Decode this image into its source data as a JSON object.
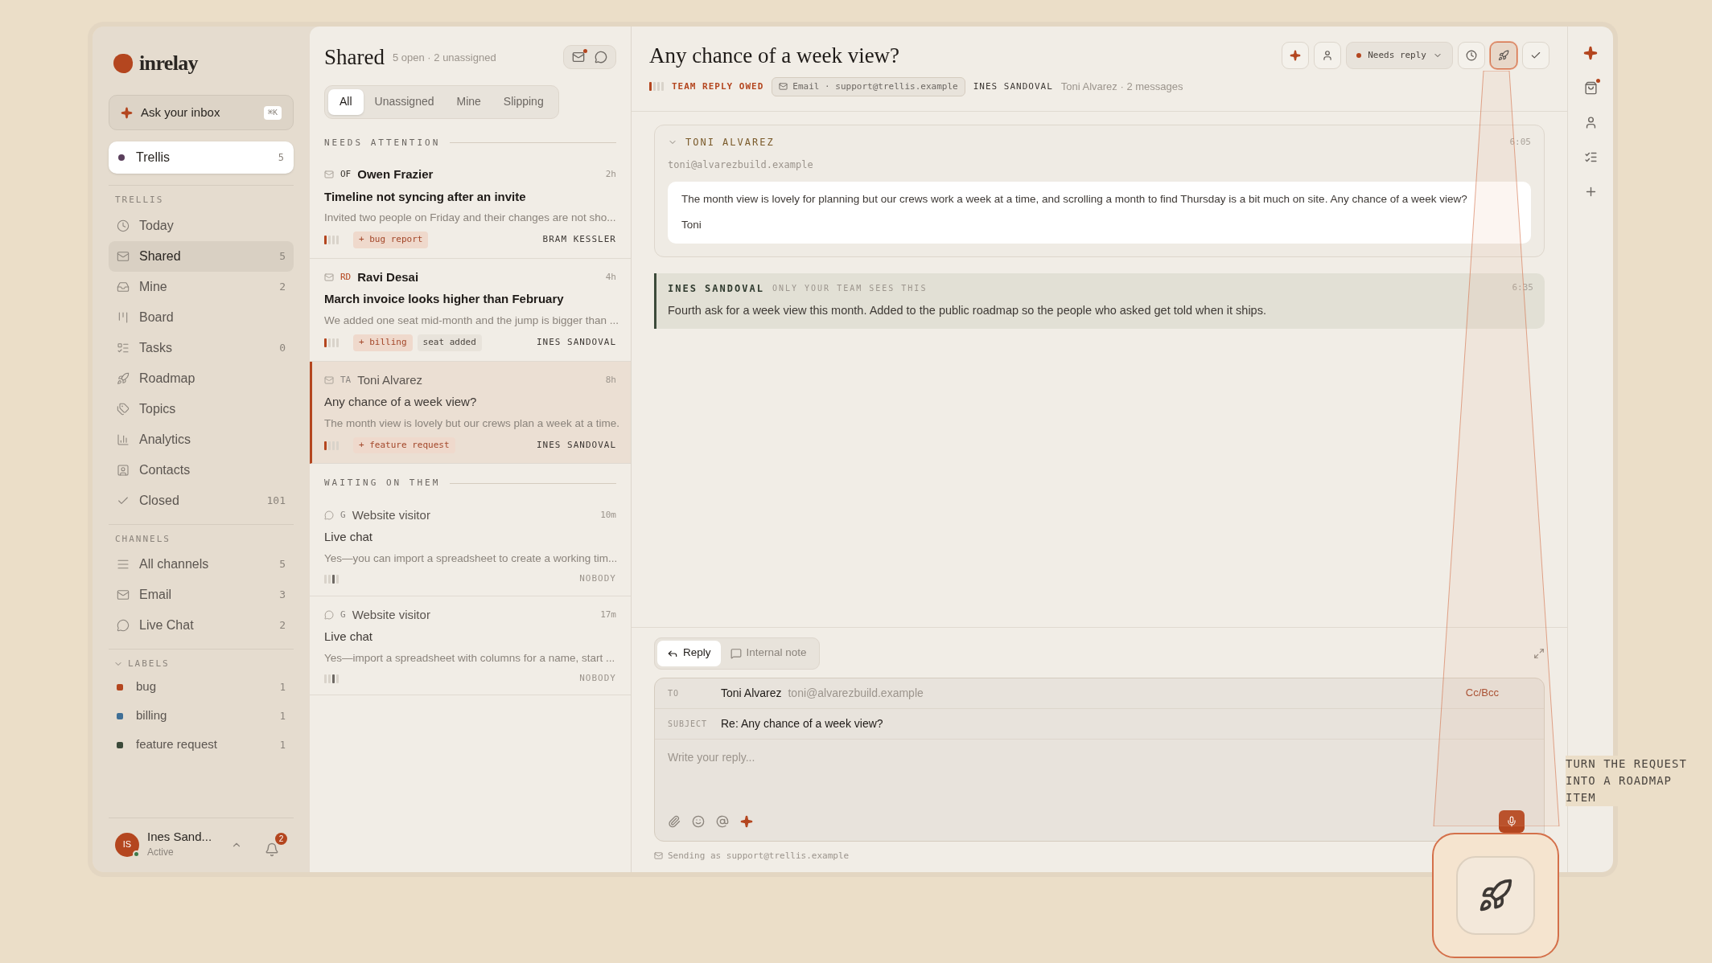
{
  "brand": {
    "name": "inrelay"
  },
  "ask": {
    "label": "Ask your inbox",
    "shortcut": "⌘K"
  },
  "workspace": {
    "name": "Trellis",
    "count": "5",
    "color": "#5a3f5c",
    "selected": true
  },
  "sidebar": {
    "section": "TRELLIS",
    "items": [
      {
        "label": "Today",
        "selected": false
      },
      {
        "label": "Shared",
        "count": "5",
        "selected": true
      },
      {
        "label": "Mine",
        "count": "2",
        "selected": false
      },
      {
        "label": "Board",
        "selected": false
      },
      {
        "label": "Tasks",
        "count": "0",
        "selected": false
      },
      {
        "label": "Roadmap",
        "selected": false
      },
      {
        "label": "Topics",
        "selected": false
      },
      {
        "label": "Analytics",
        "selected": false
      },
      {
        "label": "Contacts",
        "selected": false
      },
      {
        "label": "Closed",
        "count": "101",
        "selected": false
      }
    ]
  },
  "channels": {
    "section": "CHANNELS",
    "items": [
      {
        "label": "All channels",
        "count": "5",
        "selected": false
      },
      {
        "label": "Email",
        "count": "3",
        "selected": false
      },
      {
        "label": "Live Chat",
        "count": "2",
        "selected": false
      }
    ]
  },
  "labels": {
    "section": "LABELS",
    "expanded": true,
    "items": [
      {
        "label": "bug",
        "count": "1",
        "color": "#b4461f"
      },
      {
        "label": "billing",
        "count": "1",
        "color": "#3f6f96"
      },
      {
        "label": "feature request",
        "count": "1",
        "color": "#3c4a3a"
      }
    ]
  },
  "user": {
    "initials": "IS",
    "name": "Ines Sand...",
    "status": "Active",
    "online": true,
    "notifications": "2"
  },
  "list": {
    "title": "Shared",
    "summary": "5 open · 2 unassigned",
    "unread_mail": true,
    "filters": [
      {
        "label": "All",
        "selected": true
      },
      {
        "label": "Unassigned",
        "selected": false
      },
      {
        "label": "Mine",
        "selected": false
      },
      {
        "label": "Slipping",
        "selected": false
      }
    ],
    "groups": [
      {
        "title": "NEEDS ATTENTION",
        "conversations": [
          {
            "kind": "email",
            "initials": "OF",
            "color": "#3a3530",
            "name": "Owen Frazier",
            "time": "2h",
            "subject": "Timeline not syncing after an invite",
            "preview": "Invited two people on Friday and their changes are not sho...",
            "urgent": true,
            "unread": true,
            "selected": false,
            "tags": [
              {
                "kind": "label",
                "text": "+ bug report"
              }
            ],
            "assignee": "BRAM KESSLER"
          },
          {
            "kind": "email",
            "initials": "RD",
            "color": "#b4461f",
            "name": "Ravi Desai",
            "time": "4h",
            "subject": "March invoice looks higher than February",
            "preview": "We added one seat mid-month and the jump is bigger than ...",
            "urgent": true,
            "unread": true,
            "selected": false,
            "tags": [
              {
                "kind": "label",
                "text": "+ billing"
              },
              {
                "kind": "plain",
                "text": "seat added"
              }
            ],
            "assignee": "INES SANDOVAL"
          },
          {
            "kind": "email",
            "initials": "TA",
            "color": "#8a8580",
            "name": "Toni Alvarez",
            "time": "8h",
            "subject": "Any chance of a week view?",
            "preview": "The month view is lovely but our crews plan a week at a time.",
            "urgent": true,
            "unread": false,
            "selected": true,
            "tags": [
              {
                "kind": "label",
                "text": "+ feature request"
              }
            ],
            "assignee": "INES SANDOVAL"
          }
        ]
      },
      {
        "title": "WAITING ON THEM",
        "conversations": [
          {
            "kind": "chat",
            "initials": "G",
            "color": "#8a8580",
            "name": "Website visitor",
            "time": "10m",
            "subject": "Live chat",
            "preview": "Yes—you can import a spreadsheet to create a working tim...",
            "urgent": false,
            "unread": false,
            "selected": false,
            "assignee": "NOBODY"
          },
          {
            "kind": "chat",
            "initials": "G",
            "color": "#8a8580",
            "name": "Website visitor",
            "time": "17m",
            "subject": "Live chat",
            "preview": "Yes—import a spreadsheet with columns for a name, start ...",
            "urgent": false,
            "unread": false,
            "selected": false,
            "assignee": "NOBODY"
          }
        ]
      }
    ]
  },
  "thread": {
    "title": "Any chance of a week view?",
    "urgent": true,
    "status": "TEAM REPLY OWED",
    "channel": "Email · support@trellis.example",
    "assignee": "INES SANDOVAL",
    "meta": "Toni Alvarez · 2 messages",
    "status_button": "Needs reply",
    "roadmap_highlighted": true,
    "messages": [
      {
        "kind": "email",
        "author": "TONI ALVAREZ",
        "expanded": true,
        "time": "6:05",
        "email": "toni@alvarezbuild.example",
        "body": [
          "The month view is lovely for planning but our crews work a week at a time, and scrolling a month to find Thursday is a bit much on site. Any chance of a week view?",
          "Toni"
        ]
      },
      {
        "kind": "note",
        "author": "INES SANDOVAL",
        "visibility": "ONLY YOUR TEAM SEES THIS",
        "time": "6:35",
        "body": [
          "Fourth ask for a week view this month. Added to the public roadmap so the people who asked get told when it ships."
        ]
      }
    ]
  },
  "composer": {
    "modes": [
      {
        "label": "Reply",
        "selected": true
      },
      {
        "label": "Internal note",
        "selected": false
      }
    ],
    "to_label": "TO",
    "to_name": "Toni Alvarez",
    "to_email": "toni@alvarezbuild.example",
    "cc": "Cc/Bcc",
    "subject_label": "SUBJECT",
    "subject": "Re: Any chance of a week view?",
    "placeholder": "Write your reply...",
    "sending": "Sending as support@trellis.example"
  },
  "rail": {
    "cart_alert": true
  },
  "callout": {
    "caption": "TURN THE REQUEST INTO A ROADMAP ITEM"
  }
}
